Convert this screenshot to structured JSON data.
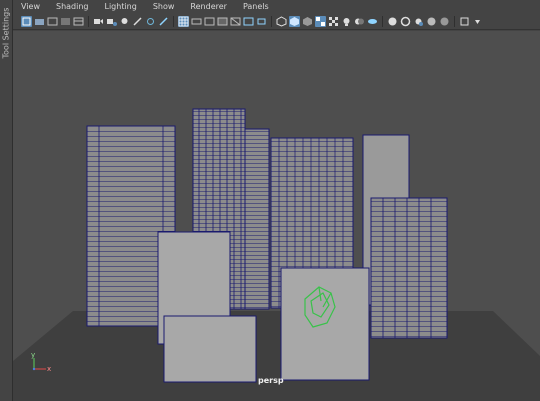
{
  "side_panel": {
    "label": "Tool Settings"
  },
  "menu": [
    "View",
    "Shading",
    "Lighting",
    "Show",
    "Renderer",
    "Panels"
  ],
  "toolbar_icons": [
    "select-camera",
    "camera-attr",
    "bookmarks",
    "image-plane",
    "2d-pan",
    "grease-pencil",
    "grid",
    "film-gate",
    "resolution-gate",
    "gate-mask",
    "field-chart",
    "safe-action",
    "safe-title",
    "wireframe",
    "smooth-shade",
    "default-material",
    "textured",
    "use-all-lights",
    "shadows",
    "screen-space-ao",
    "motion-blur",
    "anti-alias",
    "depth-of-field",
    "isolate-select",
    "xray",
    "xray-joints",
    "xray-components"
  ],
  "viewport": {
    "camera_label": "persp",
    "axis_y": "y",
    "axis_x": "x"
  },
  "colors": {
    "background": "#4e4e4e",
    "wireframe": "#1a1a6e",
    "selected_wire": "#39c24a",
    "active_icon": "#5b8cb9"
  }
}
